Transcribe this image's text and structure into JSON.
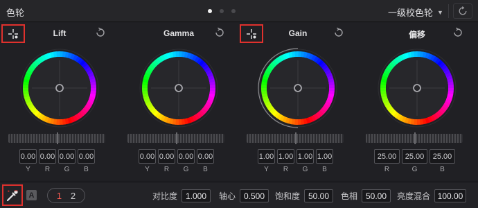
{
  "header": {
    "title": "色轮",
    "page_dots": [
      true,
      false,
      false
    ],
    "mode_label": "一级校色轮",
    "mode_icon": "chevron-down-icon",
    "reset_icon": "reset-all-icon"
  },
  "wheels": [
    {
      "name": "Lift",
      "picker": true,
      "picker_highlight": true,
      "values": [
        "0.00",
        "0.00",
        "0.00",
        "0.00"
      ],
      "labels": [
        "Y",
        "R",
        "G",
        "B"
      ]
    },
    {
      "name": "Gamma",
      "picker": false,
      "picker_highlight": false,
      "values": [
        "0.00",
        "0.00",
        "0.00",
        "0.00"
      ],
      "labels": [
        "Y",
        "R",
        "G",
        "B"
      ]
    },
    {
      "name": "Gain",
      "picker": true,
      "picker_highlight": true,
      "values": [
        "1.00",
        "1.00",
        "1.00",
        "1.00"
      ],
      "labels": [
        "Y",
        "R",
        "G",
        "B"
      ]
    },
    {
      "name": "偏移",
      "picker": false,
      "picker_highlight": false,
      "values": [
        "25.00",
        "25.00",
        "25.00"
      ],
      "labels": [
        "R",
        "G",
        "B"
      ]
    }
  ],
  "footer": {
    "auto_label": "A",
    "pages": [
      "1",
      "2"
    ],
    "active_page": "1",
    "params": [
      {
        "label": "对比度",
        "value": "1.000"
      },
      {
        "label": "轴心",
        "value": "0.500"
      },
      {
        "label": "饱和度",
        "value": "50.00"
      },
      {
        "label": "色相",
        "value": "50.00"
      },
      {
        "label": "亮度混合",
        "value": "100.00"
      }
    ]
  },
  "colors": {
    "highlight": "#e0312d",
    "active_page": "#ff5b52"
  }
}
